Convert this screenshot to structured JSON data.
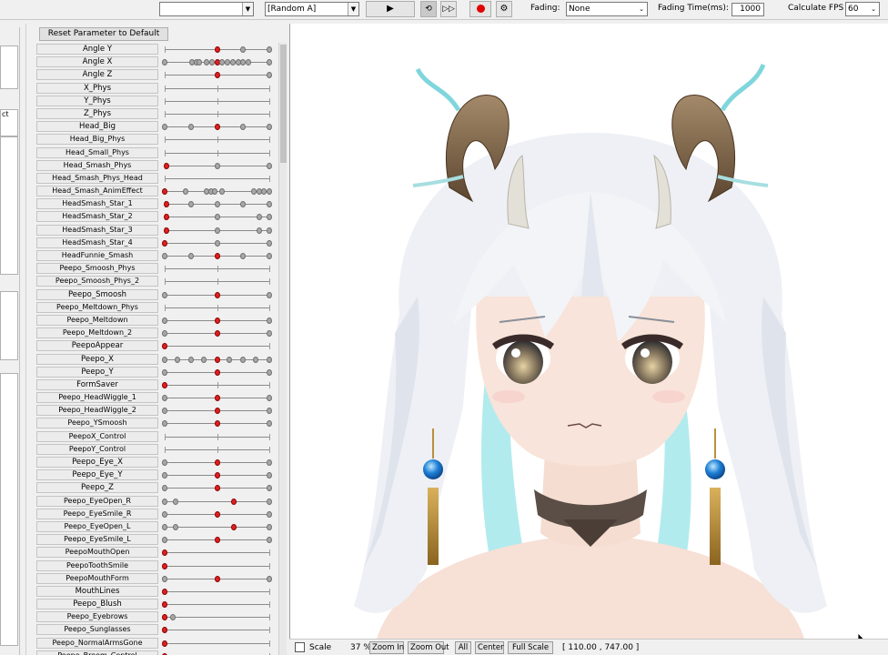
{
  "toolbar": {
    "combo1_value": "",
    "combo2_value": "[Random A]",
    "play_icon": "play-icon",
    "fading_label": "Fading:",
    "fading_value": "None",
    "fading_time_label": "Fading Time(ms):",
    "fading_time_value": "1000",
    "fps_label": "Calculate FPS",
    "fps_value": "60"
  },
  "left_sliver": {
    "text": "ct"
  },
  "params": {
    "reset_label": "Reset Parameter to Default",
    "rows": [
      {
        "name": "Angle Y",
        "big": true,
        "ticks": [
          0,
          0.5,
          1
        ],
        "knobs": [
          [
            0.5,
            1
          ],
          [
            0.75,
            0
          ],
          [
            1,
            0
          ]
        ]
      },
      {
        "name": "Angle X",
        "big": true,
        "ticks": [
          0,
          1
        ],
        "knobs": [
          [
            0,
            0
          ],
          [
            0.26,
            0
          ],
          [
            0.3,
            0
          ],
          [
            0.33,
            0
          ],
          [
            0.4,
            0
          ],
          [
            0.45,
            0
          ],
          [
            0.5,
            1
          ],
          [
            0.55,
            0
          ],
          [
            0.6,
            0
          ],
          [
            0.65,
            0
          ],
          [
            0.7,
            0
          ],
          [
            0.75,
            0
          ],
          [
            0.8,
            0
          ],
          [
            1,
            0
          ]
        ]
      },
      {
        "name": "Angle Z",
        "big": true,
        "ticks": [
          0,
          0.5,
          1
        ],
        "knobs": [
          [
            0.5,
            1
          ],
          [
            1,
            0
          ]
        ]
      },
      {
        "name": "X_Phys",
        "big": true,
        "ticks": [
          0,
          0.5,
          1
        ],
        "knobs": []
      },
      {
        "name": "Y_Phys",
        "big": true,
        "ticks": [
          0,
          0.5,
          1
        ],
        "knobs": []
      },
      {
        "name": "Z_Phys",
        "big": true,
        "ticks": [
          0,
          0.5,
          1
        ],
        "knobs": []
      },
      {
        "name": "Head_Big",
        "big": true,
        "ticks": [
          0,
          1
        ],
        "knobs": [
          [
            0,
            0
          ],
          [
            0.25,
            0
          ],
          [
            0.5,
            1
          ],
          [
            0.75,
            0
          ],
          [
            1,
            0
          ]
        ]
      },
      {
        "name": "Head_Big_Phys",
        "big": false,
        "ticks": [
          0,
          0.5,
          1
        ],
        "knobs": []
      },
      {
        "name": "Head_Small_Phys",
        "big": false,
        "ticks": [
          0,
          0.5,
          1
        ],
        "knobs": []
      },
      {
        "name": "Head_Smash_Phys",
        "big": false,
        "ticks": [
          0,
          1
        ],
        "knobs": [
          [
            0.02,
            1
          ],
          [
            0.5,
            0
          ],
          [
            1,
            0
          ]
        ]
      },
      {
        "name": "Head_Smash_Phys_Head",
        "big": false,
        "ticks": [
          0,
          1
        ],
        "knobs": []
      },
      {
        "name": "Head_Smash_AnimEffect",
        "big": false,
        "ticks": [
          0,
          1
        ],
        "knobs": [
          [
            0,
            1
          ],
          [
            0.2,
            0
          ],
          [
            0.4,
            0
          ],
          [
            0.44,
            0
          ],
          [
            0.48,
            0
          ],
          [
            0.55,
            0
          ],
          [
            0.85,
            0
          ],
          [
            0.9,
            0
          ],
          [
            0.95,
            0
          ],
          [
            1,
            0
          ]
        ]
      },
      {
        "name": "HeadSmash_Star_1",
        "big": false,
        "ticks": [
          0,
          1
        ],
        "knobs": [
          [
            0.02,
            1
          ],
          [
            0.25,
            0
          ],
          [
            0.5,
            0
          ],
          [
            0.75,
            0
          ],
          [
            1,
            0
          ]
        ]
      },
      {
        "name": "HeadSmash_Star_2",
        "big": false,
        "ticks": [
          0,
          1
        ],
        "knobs": [
          [
            0.02,
            1
          ],
          [
            0.5,
            0
          ],
          [
            0.9,
            0
          ],
          [
            1,
            0
          ]
        ]
      },
      {
        "name": "HeadSmash_Star_3",
        "big": false,
        "ticks": [
          0,
          1
        ],
        "knobs": [
          [
            0.02,
            1
          ],
          [
            0.5,
            0
          ],
          [
            0.9,
            0
          ],
          [
            1,
            0
          ]
        ]
      },
      {
        "name": "HeadSmash_Star_4",
        "big": false,
        "ticks": [
          0,
          1
        ],
        "knobs": [
          [
            0,
            1
          ],
          [
            0.5,
            0
          ],
          [
            1,
            0
          ]
        ]
      },
      {
        "name": "HeadFunnie_Smash",
        "big": false,
        "ticks": [
          0,
          1
        ],
        "knobs": [
          [
            0,
            0
          ],
          [
            0.25,
            0
          ],
          [
            0.5,
            1
          ],
          [
            0.75,
            0
          ],
          [
            1,
            0
          ]
        ]
      },
      {
        "name": "Peepo_Smoosh_Phys",
        "big": false,
        "ticks": [
          0,
          0.5,
          1
        ],
        "knobs": []
      },
      {
        "name": "Peepo_Smoosh_Phys_2",
        "big": false,
        "ticks": [
          0,
          0.5,
          1
        ],
        "knobs": []
      },
      {
        "name": "Peepo_Smoosh",
        "big": true,
        "ticks": [
          0,
          1
        ],
        "knobs": [
          [
            0,
            0
          ],
          [
            0.5,
            1
          ],
          [
            1,
            0
          ]
        ]
      },
      {
        "name": "Peepo_Meltdown_Phys",
        "big": false,
        "ticks": [
          0,
          0.5,
          1
        ],
        "knobs": []
      },
      {
        "name": "Peepo_Meltdown",
        "big": false,
        "ticks": [
          0,
          1
        ],
        "knobs": [
          [
            0,
            0
          ],
          [
            0.5,
            1
          ],
          [
            1,
            0
          ]
        ]
      },
      {
        "name": "Peepo_Meltdown_2",
        "big": false,
        "ticks": [
          0,
          1
        ],
        "knobs": [
          [
            0,
            0
          ],
          [
            0.5,
            1
          ],
          [
            1,
            0
          ]
        ]
      },
      {
        "name": "PeepoAppear",
        "big": true,
        "ticks": [
          0,
          1
        ],
        "knobs": [
          [
            0,
            1
          ]
        ]
      },
      {
        "name": "Peepo_X",
        "big": true,
        "ticks": [
          0,
          1
        ],
        "knobs": [
          [
            0,
            0
          ],
          [
            0.12,
            0
          ],
          [
            0.25,
            0
          ],
          [
            0.37,
            0
          ],
          [
            0.5,
            1
          ],
          [
            0.62,
            0
          ],
          [
            0.75,
            0
          ],
          [
            0.87,
            0
          ],
          [
            1,
            0
          ]
        ]
      },
      {
        "name": "Peepo_Y",
        "big": true,
        "ticks": [
          0,
          1
        ],
        "knobs": [
          [
            0,
            0
          ],
          [
            0.5,
            1
          ],
          [
            1,
            0
          ]
        ]
      },
      {
        "name": "FormSaver",
        "big": true,
        "ticks": [
          0,
          0.5,
          1
        ],
        "knobs": [
          [
            0,
            1
          ]
        ]
      },
      {
        "name": "Peepo_HeadWiggle_1",
        "big": false,
        "ticks": [
          0,
          1
        ],
        "knobs": [
          [
            0,
            0
          ],
          [
            0.5,
            1
          ],
          [
            1,
            0
          ]
        ]
      },
      {
        "name": "Peepo_HeadWiggle_2",
        "big": false,
        "ticks": [
          0,
          1
        ],
        "knobs": [
          [
            0,
            0
          ],
          [
            0.5,
            1
          ],
          [
            1,
            0
          ]
        ]
      },
      {
        "name": "Peepo_YSmoosh",
        "big": false,
        "ticks": [
          0,
          1
        ],
        "knobs": [
          [
            0,
            0
          ],
          [
            0.5,
            1
          ],
          [
            1,
            0
          ]
        ]
      },
      {
        "name": "PeepoX_Control",
        "big": false,
        "ticks": [
          0,
          0.5,
          1
        ],
        "knobs": []
      },
      {
        "name": "PeepoY_Control",
        "big": false,
        "ticks": [
          0,
          0.5,
          1
        ],
        "knobs": []
      },
      {
        "name": "Peepo_Eye_X",
        "big": true,
        "ticks": [
          0,
          1
        ],
        "knobs": [
          [
            0,
            0
          ],
          [
            0.5,
            1
          ],
          [
            1,
            0
          ]
        ]
      },
      {
        "name": "Peepo_Eye_Y",
        "big": true,
        "ticks": [
          0,
          1
        ],
        "knobs": [
          [
            0,
            0
          ],
          [
            0.5,
            1
          ],
          [
            1,
            0
          ]
        ]
      },
      {
        "name": "Peepo_Z",
        "big": true,
        "ticks": [
          0,
          1
        ],
        "knobs": [
          [
            0,
            0
          ],
          [
            0.5,
            1
          ],
          [
            1,
            0
          ]
        ]
      },
      {
        "name": "Peepo_EyeOpen_R",
        "big": false,
        "ticks": [
          0,
          1
        ],
        "knobs": [
          [
            0,
            0
          ],
          [
            0.1,
            0
          ],
          [
            0.66,
            1
          ],
          [
            1,
            0
          ]
        ]
      },
      {
        "name": "Peepo_EyeSmile_R",
        "big": false,
        "ticks": [
          0,
          1
        ],
        "knobs": [
          [
            0,
            0
          ],
          [
            0.5,
            1
          ],
          [
            1,
            0
          ]
        ]
      },
      {
        "name": "Peepo_EyeOpen_L",
        "big": false,
        "ticks": [
          0,
          1
        ],
        "knobs": [
          [
            0,
            0
          ],
          [
            0.1,
            0
          ],
          [
            0.66,
            1
          ],
          [
            1,
            0
          ]
        ]
      },
      {
        "name": "Peepo_EyeSmile_L",
        "big": false,
        "ticks": [
          0,
          1
        ],
        "knobs": [
          [
            0,
            0
          ],
          [
            0.5,
            1
          ],
          [
            1,
            0
          ]
        ]
      },
      {
        "name": "PeepoMouthOpen",
        "big": false,
        "ticks": [
          0,
          1
        ],
        "knobs": [
          [
            0,
            1
          ]
        ]
      },
      {
        "name": "PeepoToothSmile",
        "big": false,
        "ticks": [
          0,
          1
        ],
        "knobs": [
          [
            0,
            1
          ]
        ]
      },
      {
        "name": "PeepoMouthForm",
        "big": false,
        "ticks": [
          0,
          1
        ],
        "knobs": [
          [
            0,
            0
          ],
          [
            0.5,
            1
          ],
          [
            1,
            0
          ]
        ]
      },
      {
        "name": "MouthLines",
        "big": true,
        "ticks": [
          0,
          1
        ],
        "knobs": [
          [
            0,
            1
          ]
        ]
      },
      {
        "name": "Peepo_Blush",
        "big": true,
        "ticks": [
          0,
          1
        ],
        "knobs": [
          [
            0,
            1
          ]
        ]
      },
      {
        "name": "Peepo_Eyebrows",
        "big": false,
        "ticks": [
          0,
          1
        ],
        "knobs": [
          [
            0,
            1
          ],
          [
            0.08,
            0
          ]
        ]
      },
      {
        "name": "Peepo_Sunglasses",
        "big": false,
        "ticks": [
          0,
          1
        ],
        "knobs": [
          [
            0,
            1
          ]
        ]
      },
      {
        "name": "Peepo_NormalArmsGone",
        "big": false,
        "ticks": [
          0,
          1
        ],
        "knobs": [
          [
            0,
            1
          ]
        ]
      },
      {
        "name": "Peepo_Broom_Control",
        "big": false,
        "ticks": [
          0,
          1
        ],
        "knobs": [
          [
            0,
            1
          ]
        ]
      }
    ]
  },
  "status": {
    "scale_label": "Scale",
    "zoom_value": "37 %",
    "zoom_in": "Zoom In",
    "zoom_out": "Zoom Out",
    "all": "All",
    "center": "Center",
    "full_scale": "Full Scale",
    "coords": "[  110.00 ,  747.00 ]"
  },
  "colors": {
    "active_knob": "#e02020",
    "inactive_knob": "#a8a8a8",
    "accent_record": "#e00000"
  }
}
